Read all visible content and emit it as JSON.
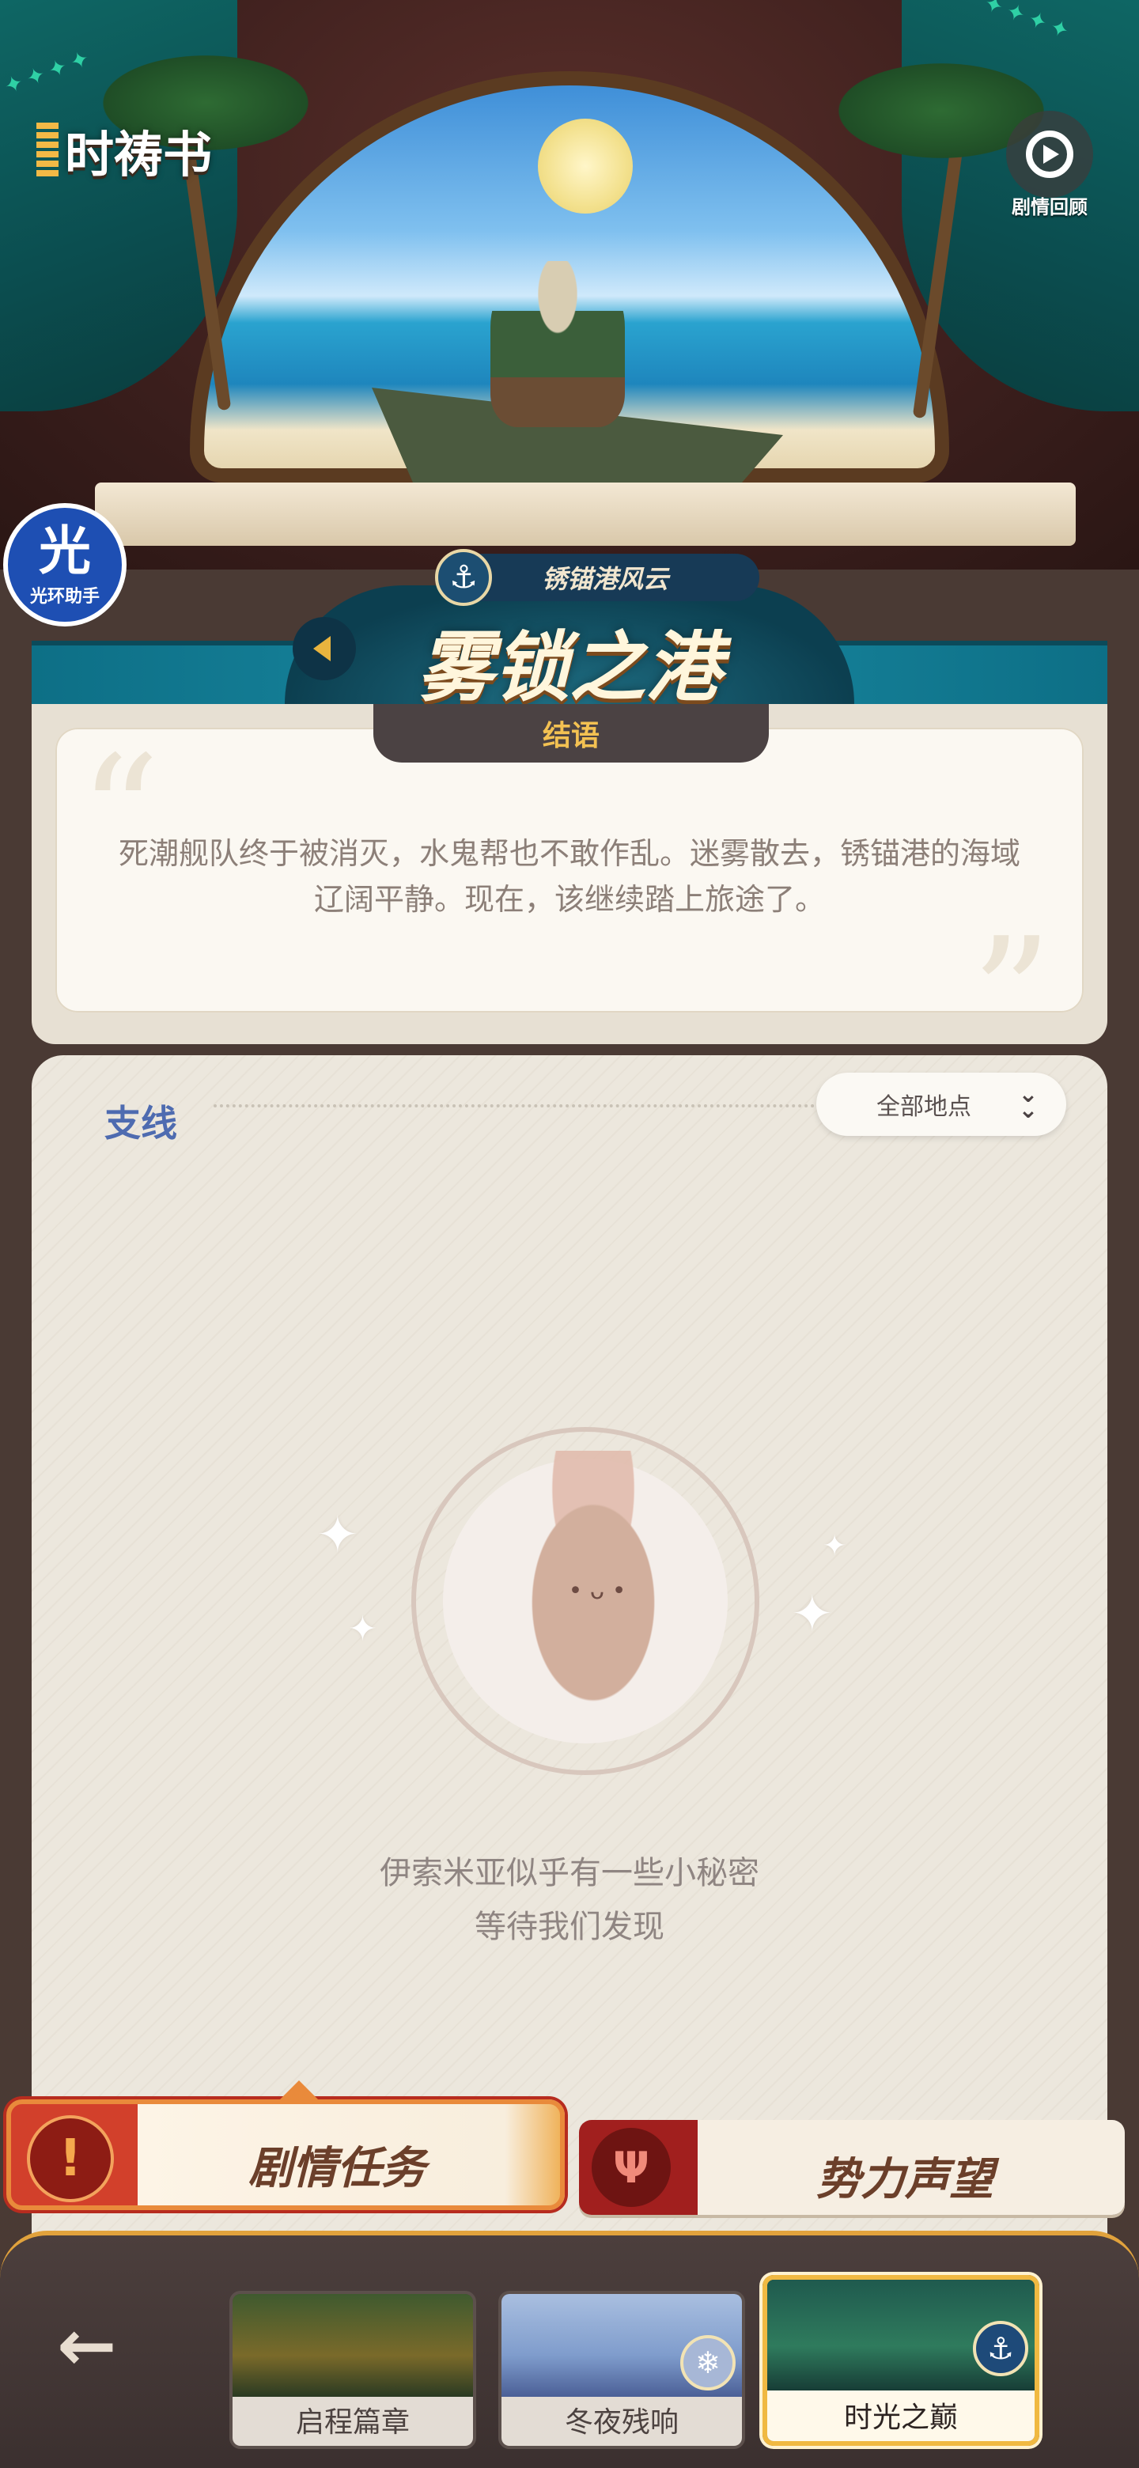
{
  "header": {
    "logo_text": "时祷书",
    "review_label": "剧情回顾",
    "review_icon": "replay-icon"
  },
  "assistant": {
    "glyph": "光",
    "label": "光环助手"
  },
  "chapter": {
    "subtitle": "锈锚港风云",
    "title": "雾锁之港",
    "anchor_icon": "anchor-icon",
    "back_icon": "chevron-left-icon"
  },
  "epilogue": {
    "tab_label": "结语",
    "text": "死潮舰队终于被消灭，水鬼帮也不敢作乱。迷雾散去，锈锚港的海域辽阔平静。现在，该继续踏上旅途了。"
  },
  "side_quests": {
    "title": "支线",
    "filter_label": "全部地点",
    "empty_line1": "伊索米亚似乎有一些小秘密",
    "empty_line2": "等待我们发现"
  },
  "tabs": {
    "story_label": "剧情任务",
    "reputation_label": "势力声望"
  },
  "bottom_nav": {
    "back_icon": "arrow-left-icon",
    "chapters": [
      {
        "label": "启程篇章",
        "active": false
      },
      {
        "label": "冬夜残响",
        "active": false
      },
      {
        "label": "时光之巅",
        "active": true
      }
    ]
  },
  "colors": {
    "accent_gold": "#f0b942",
    "banner_teal": "#0d6f86",
    "side_title_blue": "#4e6bb0",
    "story_red": "#d2402b"
  }
}
